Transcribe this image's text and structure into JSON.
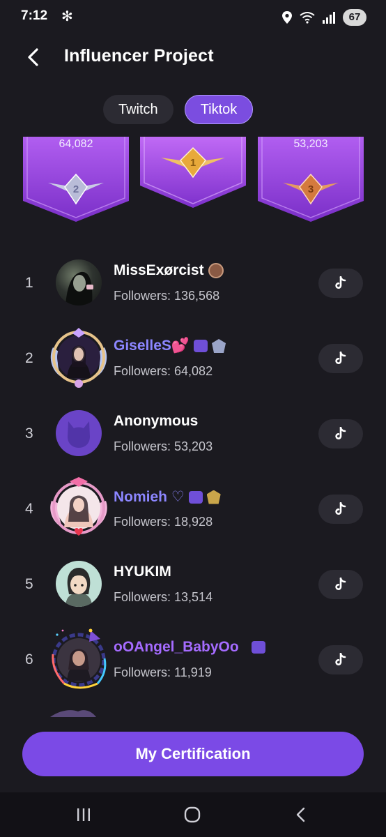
{
  "status_bar": {
    "time": "7:12",
    "battery": "67"
  },
  "header": {
    "title": "Influencer Project"
  },
  "tabs": [
    {
      "label": "Twitch",
      "active": false
    },
    {
      "label": "Tiktok",
      "active": true
    }
  ],
  "podium": {
    "second_value": "64,082",
    "third_value": "53,203",
    "rank_labels": [
      "2",
      "1",
      "3"
    ]
  },
  "followers_label": "Followers:",
  "entries": [
    {
      "rank": "1",
      "name": "MissExørcist",
      "followers": "Followers: 136,568"
    },
    {
      "rank": "2",
      "name": "GiselleS💕",
      "followers": "Followers: 64,082"
    },
    {
      "rank": "3",
      "name": "Anonymous",
      "followers": "Followers: 53,203"
    },
    {
      "rank": "4",
      "name": "Nomieh ♡",
      "followers": "Followers: 18,928"
    },
    {
      "rank": "5",
      "name": "HYUKIM",
      "followers": "Followers: 13,514"
    },
    {
      "rank": "6",
      "name": "oOAngel_BabyOo",
      "followers": "Followers: 11,919"
    }
  ],
  "cta": {
    "label": "My Certification"
  },
  "colors": {
    "background": "#1b1a20",
    "accent": "#7b4ae6",
    "name_purple": "#8c86ff",
    "name_violet": "#a56bff",
    "gold": "#e8a93a",
    "silver": "#b9bcd8",
    "bronze": "#d47a3e"
  },
  "icons": [
    "back-arrow-icon",
    "tiktok-icon",
    "location-icon",
    "wifi-icon",
    "signal-icon",
    "recent-apps-icon",
    "home-icon",
    "back-nav-icon"
  ]
}
